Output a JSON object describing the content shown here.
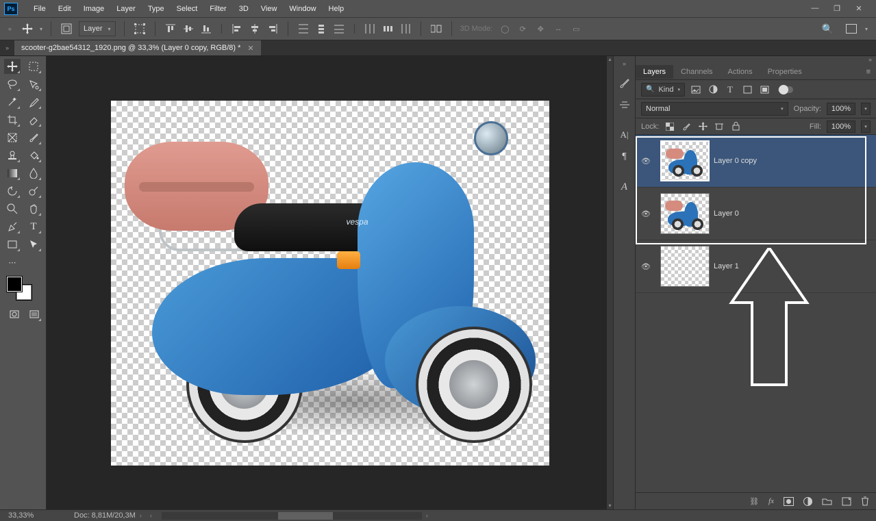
{
  "menu": {
    "items": [
      "File",
      "Edit",
      "Image",
      "Layer",
      "Type",
      "Select",
      "Filter",
      "3D",
      "View",
      "Window",
      "Help"
    ]
  },
  "options": {
    "layer_target": "Layer",
    "mode_label": "3D Mode:"
  },
  "document_tab": {
    "title": "scooter-g2bae54312_1920.png @ 33,3% (Layer 0 copy, RGB/8) *"
  },
  "panels": {
    "tabs": [
      "Layers",
      "Channels",
      "Actions",
      "Properties"
    ],
    "filter_kind": "Kind",
    "blend_mode": "Normal",
    "opacity_label": "Opacity:",
    "opacity_value": "100%",
    "lock_label": "Lock:",
    "fill_label": "Fill:",
    "fill_value": "100%"
  },
  "layers": [
    {
      "name": "Layer 0 copy",
      "selected": true,
      "has_image": true
    },
    {
      "name": "Layer 0",
      "selected": false,
      "has_image": true
    },
    {
      "name": "Layer 1",
      "selected": false,
      "has_image": false
    }
  ],
  "status": {
    "zoom": "33,33%",
    "doc": "Doc: 8,81M/20,3M"
  },
  "canvas_text": {
    "vespa": "vespa"
  }
}
